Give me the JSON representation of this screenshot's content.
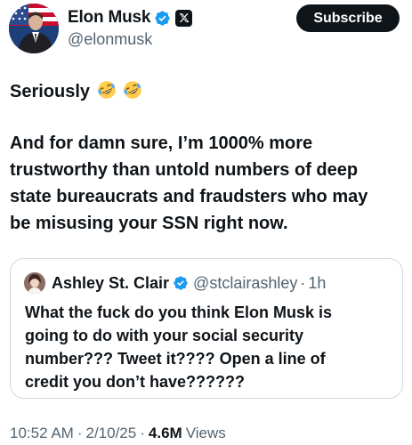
{
  "author": {
    "display_name": "Elon Musk",
    "handle": "@elonmusk",
    "verified_icon": "verified-badge-icon",
    "affiliation_icon": "x-logo-icon"
  },
  "subscribe_label": "Subscribe",
  "tweet": {
    "first_line": "Seriously",
    "first_line_emoji": [
      "rolling-on-floor-laughing",
      "rolling-on-floor-laughing"
    ],
    "body_lines": [
      "And for damn sure, I’m 1000% more",
      "trustworthy than untold numbers of deep",
      "state bureaucrats and fraudsters who may",
      "be misusing your SSN right now."
    ]
  },
  "quote": {
    "display_name": "Ashley St. Clair",
    "handle": "@stclairashley",
    "separator": "·",
    "time": "1h",
    "body_lines": [
      "What the fuck do you think Elon Musk is",
      "going to do with your social security",
      "number??? Tweet it???? Open a line of",
      "credit you don’t have??????"
    ]
  },
  "meta": {
    "time": "10:52 AM",
    "date": "2/10/25",
    "views_count": "4.6M",
    "views_label": "Views",
    "separator": "·"
  },
  "colors": {
    "text": "#0f1419",
    "secondary": "#536471",
    "verified": "#1d9bf0",
    "border": "#cfd9de"
  }
}
